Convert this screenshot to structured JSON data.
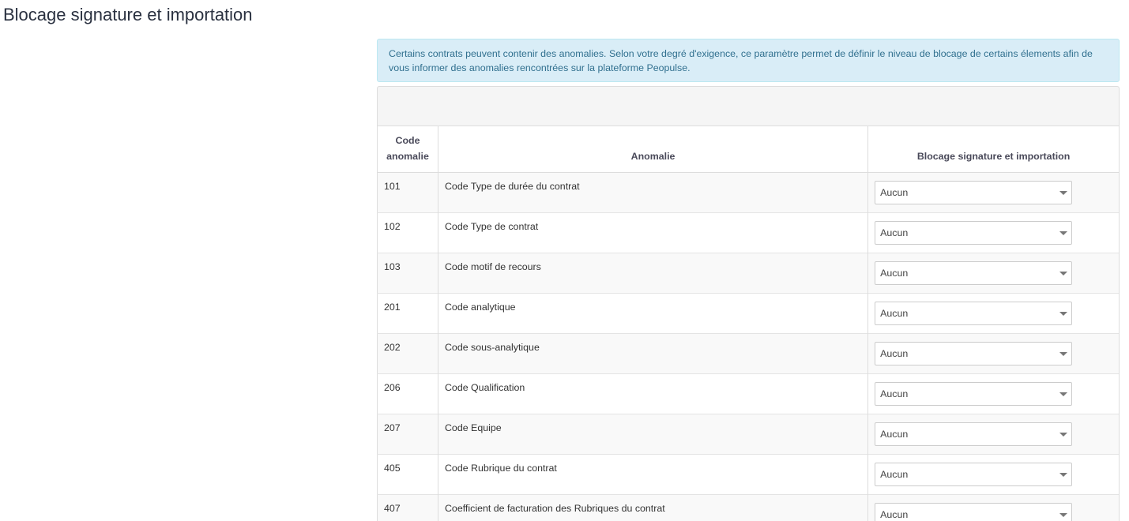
{
  "page": {
    "title": "Blocage signature et importation"
  },
  "alert": {
    "text": "Certains contrats peuvent contenir des anomalies. Selon votre degré d'exigence, ce paramètre permet de définir le niveau de blocage de certains élements afin de vous informer des anomalies rencontrées sur la plateforme Peopulse."
  },
  "table": {
    "headers": {
      "code": "Code anomalie",
      "anomalie": "Anomalie",
      "blocage": "Blocage signature et importation"
    },
    "rows": [
      {
        "code": "101",
        "label": "Code Type de durée du contrat",
        "value": "Aucun"
      },
      {
        "code": "102",
        "label": "Code Type de contrat",
        "value": "Aucun"
      },
      {
        "code": "103",
        "label": "Code motif de recours",
        "value": "Aucun"
      },
      {
        "code": "201",
        "label": "Code analytique",
        "value": "Aucun"
      },
      {
        "code": "202",
        "label": "Code sous-analytique",
        "value": "Aucun"
      },
      {
        "code": "206",
        "label": "Code Qualification",
        "value": "Aucun"
      },
      {
        "code": "207",
        "label": "Code Equipe",
        "value": "Aucun"
      },
      {
        "code": "405",
        "label": "Code Rubrique du contrat",
        "value": "Aucun"
      },
      {
        "code": "407",
        "label": "Coefficient de facturation des Rubriques du contrat",
        "value": "Aucun"
      }
    ]
  },
  "colors": {
    "alert_bg": "#d9edf7",
    "alert_text": "#31708f",
    "title": "#2a3140"
  }
}
